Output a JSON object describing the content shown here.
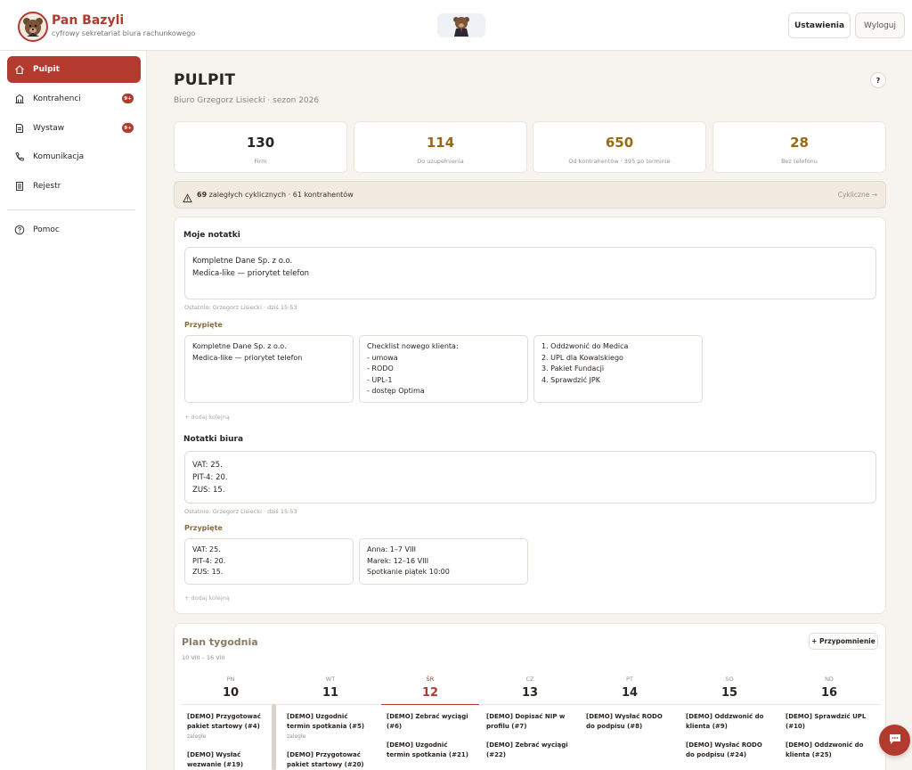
{
  "header": {
    "brand": "Pan Bazyli",
    "tagline": "cyfrowy sekretariat biura rachunkowego",
    "settings_label": "Ustawienia",
    "logout_label": "Wyloguj"
  },
  "sidebar": {
    "items": [
      {
        "label": "Pulpit",
        "icon": "home-icon",
        "active": true
      },
      {
        "label": "Kontrahenci",
        "icon": "building-icon",
        "badge": "9+"
      },
      {
        "label": "Wystaw",
        "icon": "document-icon",
        "badge": "9+"
      },
      {
        "label": "Komunikacja",
        "icon": "phone-icon"
      },
      {
        "label": "Rejestr",
        "icon": "register-icon"
      },
      {
        "label": "Pomoc",
        "icon": "help-icon"
      }
    ]
  },
  "page": {
    "title": "PULPIT",
    "subtitle": "Biuro Grzegorz Lisiecki · sezon 2026",
    "help": "?"
  },
  "stats": [
    {
      "value": "130",
      "label": "Firm",
      "color": "#2a2420"
    },
    {
      "value": "114",
      "label": "Do uzupełnienia",
      "color": "#9a6a12"
    },
    {
      "value": "650",
      "label": "Od kontrahentów · 395 po terminie",
      "color": "#9a6a12"
    },
    {
      "value": "28",
      "label": "Bez telefonu",
      "color": "#9a6a12"
    }
  ],
  "alert": {
    "count": "69",
    "text": " zaległych cyklicznych · 61 kontrahentów",
    "link": "Cykliczne →"
  },
  "my_notes": {
    "title": "Moje notatki",
    "text": "Kompletne Dane Sp. z o.o.\nMedica-like — priorytet telefon",
    "meta": "Ostatnio: Grzegorz Lisiecki · dziś 15:53",
    "pinned_title": "Przypięte",
    "pinned": [
      "Kompletne Dane Sp. z o.o.\nMedica-like — priorytet telefon",
      "Checklist nowego klienta:\n- umowa\n- RODO\n- UPL-1\n- dostęp Optima",
      "1. Oddzwonić do Medica\n2. UPL dla Kowalskiego\n3. Pakiet Fundacji\n4. Sprawdzić JPK"
    ],
    "add_more": "+ dodaj kolejną"
  },
  "office_notes": {
    "title": "Notatki biura",
    "text": "VAT: 25.\nPIT-4: 20.\nZUS: 15.",
    "meta": "Ostatnio: Grzegorz Lisiecki · dziś 15:53",
    "pinned_title": "Przypięte",
    "pinned": [
      "VAT: 25.\nPIT-4: 20.\nZUS: 15.",
      "Anna: 1–7 VIII\nMarek: 12–16 VIII\nSpotkanie piątek 10:00"
    ],
    "add_more": "+ dodaj kolejną"
  },
  "plan": {
    "title": "Plan tygodnia",
    "range": "10 VIII – 16 VIII",
    "remind_label": "+ Przypomnienie",
    "days": [
      {
        "name": "PN",
        "num": "10"
      },
      {
        "name": "WT",
        "num": "11"
      },
      {
        "name": "ŚR",
        "num": "12",
        "today": true
      },
      {
        "name": "CZ",
        "num": "13"
      },
      {
        "name": "PT",
        "num": "14"
      },
      {
        "name": "SO",
        "num": "15"
      },
      {
        "name": "ND",
        "num": "16"
      }
    ],
    "tasks": [
      [
        {
          "text": "[DEMO] Przygotować pakiet startowy (#4)",
          "note": "zaległe"
        },
        {
          "text": "[DEMO] Wysłać wezwanie (#19)"
        }
      ],
      [
        {
          "text": "[DEMO] Uzgodnić termin spotkania (#5)",
          "note": "zaległe"
        },
        {
          "text": "[DEMO] Przygotować pakiet startowy (#20)"
        }
      ],
      [
        {
          "text": "[DEMO] Zebrać wyciągi (#6)"
        },
        {
          "text": "[DEMO] Uzgodnić termin spotkania (#21)"
        }
      ],
      [
        {
          "text": "[DEMO] Dopisać NIP w profilu (#7)"
        },
        {
          "text": "[DEMO] Zebrać wyciągi (#22)"
        }
      ],
      [
        {
          "text": "[DEMO] Wysłać RODO do podpisu (#8)"
        }
      ],
      [
        {
          "text": "[DEMO] Oddzwonić do klienta (#9)"
        },
        {
          "text": "[DEMO] Wysłać RODO do podpisu (#24)"
        }
      ],
      [
        {
          "text": "[DEMO] Sprawdzić UPL (#10)"
        },
        {
          "text": "[DEMO] Oddzwonić do klienta (#25)"
        }
      ]
    ]
  }
}
